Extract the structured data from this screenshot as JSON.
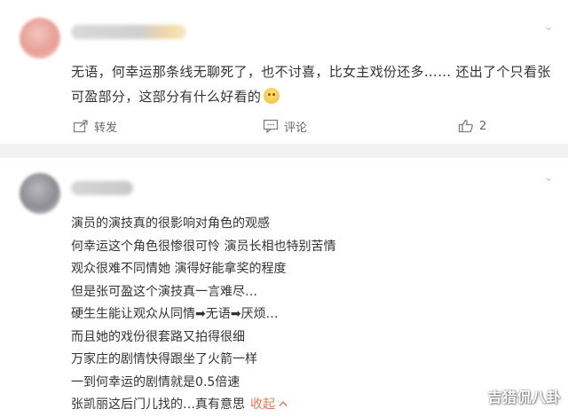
{
  "comment1": {
    "text": "无语，何幸运那条线无聊死了，也不讨喜，比女主戏份还多…… 还出了个只看张可盈部分，这部分有什么好看的",
    "emoji_icon": "smile-emoji-icon",
    "actions": {
      "share_label": "转发",
      "comment_label": "评论",
      "like_count": "2"
    }
  },
  "comment2": {
    "lines": [
      "演员的演技真的很影响对角色的观感",
      "何幸运这个角色很惨很可怜 演员长相也特别苦情",
      "观众很难不同情她 演得好能拿奖的程度",
      "但是张可盈这个演技真一言难尽…",
      "硬生生能让观众从同情➡无语➡厌烦…",
      "而且她的戏份很套路又拍得很细",
      "万家庄的剧情快得跟坐了火箭一样",
      "一到何幸运的剧情就是0.5倍速",
      "张凯丽这后门儿找的…真有意思"
    ],
    "collapse_label": "收起",
    "collapse_icon": "chevron-up-icon"
  },
  "watermark": "吉猎侃八卦",
  "colors": {
    "text": "#333333",
    "meta": "#666666",
    "link": "#eb7350",
    "divider": "#f2f2f2"
  }
}
